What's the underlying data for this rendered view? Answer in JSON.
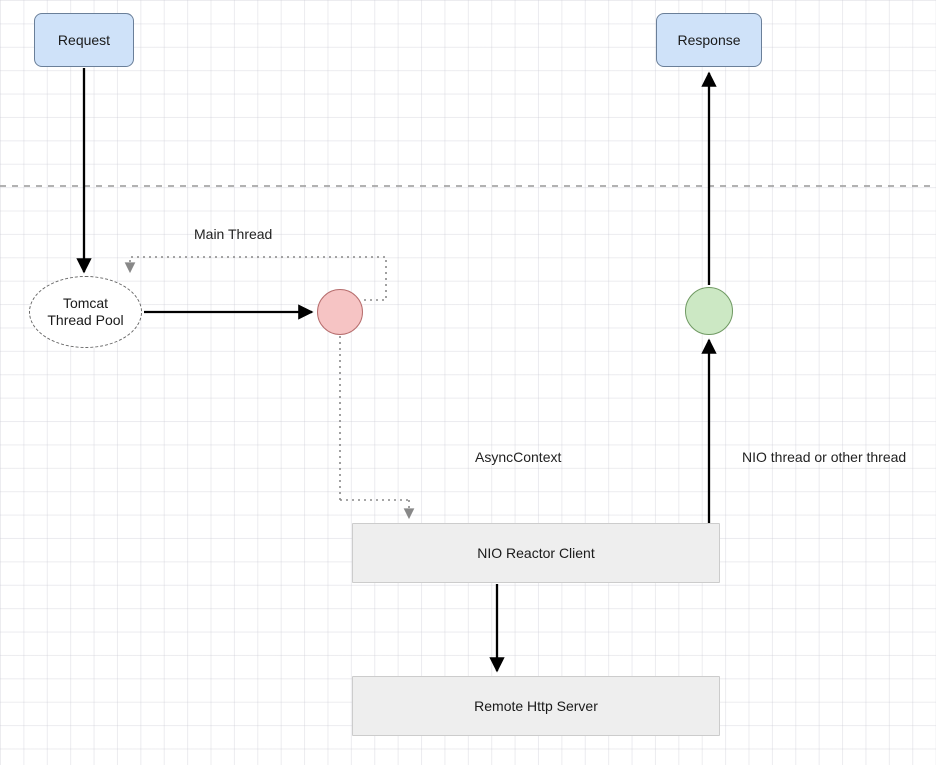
{
  "nodes": {
    "request": "Request",
    "response": "Response",
    "tomcat_pool_line1": "Tomcat",
    "tomcat_pool_line2": "Thread Pool",
    "nio_client": "NIO Reactor Client",
    "remote_server": "Remote Http Server"
  },
  "labels": {
    "main_thread": "Main Thread",
    "async_context": "AsyncContext",
    "nio_thread": "NIO thread or other thread"
  },
  "colors": {
    "request_bg": "#cfe2f9",
    "gray_bg": "#eeeeee",
    "red_circle": "#f6c4c4",
    "green_circle": "#cce8c4"
  }
}
